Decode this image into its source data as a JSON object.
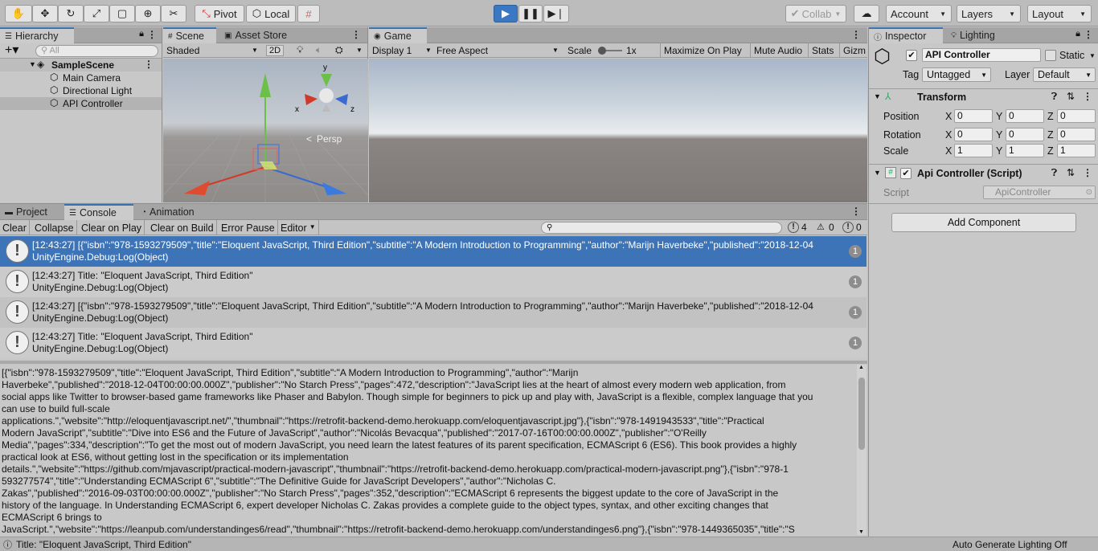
{
  "toolbar": {
    "pivot": "Pivot",
    "local": "Local",
    "collab": "Collab",
    "account": "Account",
    "layers": "Layers",
    "layout": "Layout"
  },
  "hierarchy": {
    "tab": "Hierarchy",
    "search_placeholder": "All",
    "scene": "SampleScene",
    "items": [
      "Main Camera",
      "Directional Light",
      "API Controller"
    ]
  },
  "scene": {
    "tab": "Scene",
    "tab2": "Asset Store",
    "shading": "Shaded",
    "mode2d": "2D",
    "persp": "Persp",
    "axis_y": "y",
    "axis_x": "x",
    "axis_z": "z"
  },
  "game": {
    "tab": "Game",
    "display": "Display 1",
    "aspect": "Free Aspect",
    "scale_label": "Scale",
    "scale_value": "1x",
    "maximize": "Maximize On Play",
    "mute": "Mute Audio",
    "stats": "Stats",
    "gizmos": "Gizm"
  },
  "inspector": {
    "tab": "Inspector",
    "tab2": "Lighting",
    "object_name": "API Controller",
    "static": "Static",
    "tag_label": "Tag",
    "tag_value": "Untagged",
    "layer_label": "Layer",
    "layer_value": "Default",
    "transform_title": "Transform",
    "position_label": "Position",
    "rotation_label": "Rotation",
    "scale_label": "Scale",
    "position": [
      "0",
      "0",
      "0"
    ],
    "rotation": [
      "0",
      "0",
      "0"
    ],
    "scale": [
      "1",
      "1",
      "1"
    ],
    "x": "X",
    "y": "Y",
    "z": "Z",
    "script_title": "Api Controller (Script)",
    "script_label": "Script",
    "script_value": "ApiController",
    "add_component": "Add Component"
  },
  "bottom": {
    "tab_project": "Project",
    "tab_console": "Console",
    "tab_animation": "Animation",
    "clear": "Clear",
    "collapse": "Collapse",
    "clear_on_play": "Clear on Play",
    "clear_on_build": "Clear on Build",
    "error_pause": "Error Pause",
    "editor": "Editor",
    "count_log": "4",
    "count_warn": "0",
    "count_err": "0"
  },
  "logs": [
    {
      "line1": "[12:43:27] [{\"isbn\":\"978-1593279509\",\"title\":\"Eloquent JavaScript, Third Edition\",\"subtitle\":\"A Modern Introduction to Programming\",\"author\":\"Marijn Haverbeke\",\"published\":\"2018-12-04",
      "line2": "UnityEngine.Debug:Log(Object)",
      "count": "1"
    },
    {
      "line1": "[12:43:27] Title: \"Eloquent JavaScript, Third Edition\"",
      "line2": "UnityEngine.Debug:Log(Object)",
      "count": "1"
    },
    {
      "line1": "[12:43:27] [{\"isbn\":\"978-1593279509\",\"title\":\"Eloquent JavaScript, Third Edition\",\"subtitle\":\"A Modern Introduction to Programming\",\"author\":\"Marijn Haverbeke\",\"published\":\"2018-12-04",
      "line2": "UnityEngine.Debug:Log(Object)",
      "count": "1"
    },
    {
      "line1": "[12:43:27] Title: \"Eloquent JavaScript, Third Edition\"",
      "line2": "UnityEngine.Debug:Log(Object)",
      "count": "1"
    }
  ],
  "detail_lines": [
    "[{\"isbn\":\"978-1593279509\",\"title\":\"Eloquent JavaScript, Third Edition\",\"subtitle\":\"A Modern Introduction to Programming\",\"author\":\"Marijn",
    "Haverbeke\",\"published\":\"2018-12-04T00:00:00.000Z\",\"publisher\":\"No Starch Press\",\"pages\":472,\"description\":\"JavaScript lies at the heart of almost every modern web application, from",
    "social apps like Twitter to browser-based game frameworks like Phaser and Babylon. Though simple for beginners to pick up and play with, JavaScript is a flexible, complex language that you",
    "can use to build full-scale",
    "applications.\",\"website\":\"http://eloquentjavascript.net/\",\"thumbnail\":\"https://retrofit-backend-demo.herokuapp.com/eloquentjavascript.jpg\"},{\"isbn\":\"978-1491943533\",\"title\":\"Practical",
    "Modern JavaScript\",\"subtitle\":\"Dive into ES6 and the Future of JavaScript\",\"author\":\"Nicolás Bevacqua\",\"published\":\"2017-07-16T00:00:00.000Z\",\"publisher\":\"O'Reilly",
    "Media\",\"pages\":334,\"description\":\"To get the most out of modern JavaScript, you need learn the latest features of its parent specification, ECMAScript 6 (ES6). This book provides a highly",
    "practical look at ES6, without getting lost in the specification or its implementation",
    "details.\",\"website\":\"https://github.com/mjavascript/practical-modern-javascript\",\"thumbnail\":\"https://retrofit-backend-demo.herokuapp.com/practical-modern-javascript.png\"},{\"isbn\":\"978-1",
    "593277574\",\"title\":\"Understanding ECMAScript 6\",\"subtitle\":\"The Definitive Guide for JavaScript Developers\",\"author\":\"Nicholas C.",
    "Zakas\",\"published\":\"2016-09-03T00:00:00.000Z\",\"publisher\":\"No Starch Press\",\"pages\":352,\"description\":\"ECMAScript 6 represents the biggest update to the core of JavaScript in the",
    "history of the language. In Understanding ECMAScript 6, expert developer Nicholas C. Zakas provides a complete guide to the object types, syntax, and other exciting changes that",
    "ECMAScript 6 brings to",
    "JavaScript.\",\"website\":\"https://leanpub.com/understandinges6/read\",\"thumbnail\":\"https://retrofit-backend-demo.herokuapp.com/understandinges6.png\"},{\"isbn\":\"978-1449365035\",\"title\":\"S"
  ],
  "status": {
    "message": "Title: \"Eloquent JavaScript, Third Edition\"",
    "right": "Auto Generate Lighting Off"
  }
}
